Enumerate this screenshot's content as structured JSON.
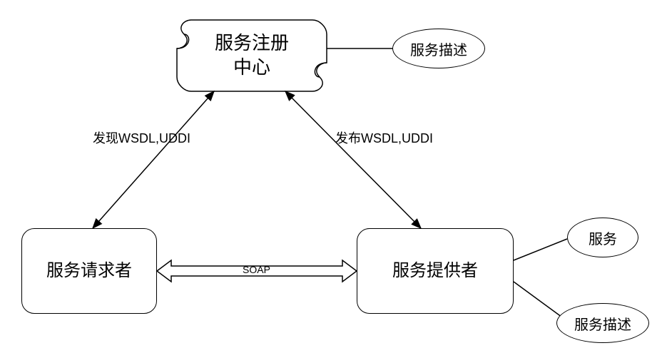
{
  "nodes": {
    "registry": {
      "label": "服务注册\n中心"
    },
    "requester": {
      "label": "服务请求者"
    },
    "provider": {
      "label": "服务提供者"
    },
    "desc_top": {
      "label": "服务描述"
    },
    "service": {
      "label": "服务"
    },
    "desc_bottom": {
      "label": "服务描述"
    }
  },
  "edges": {
    "discover": {
      "label": "发现WSDL,UDDI"
    },
    "publish": {
      "label": "发布WSDL,UDDI"
    },
    "soap": {
      "label": "SOAP"
    }
  }
}
